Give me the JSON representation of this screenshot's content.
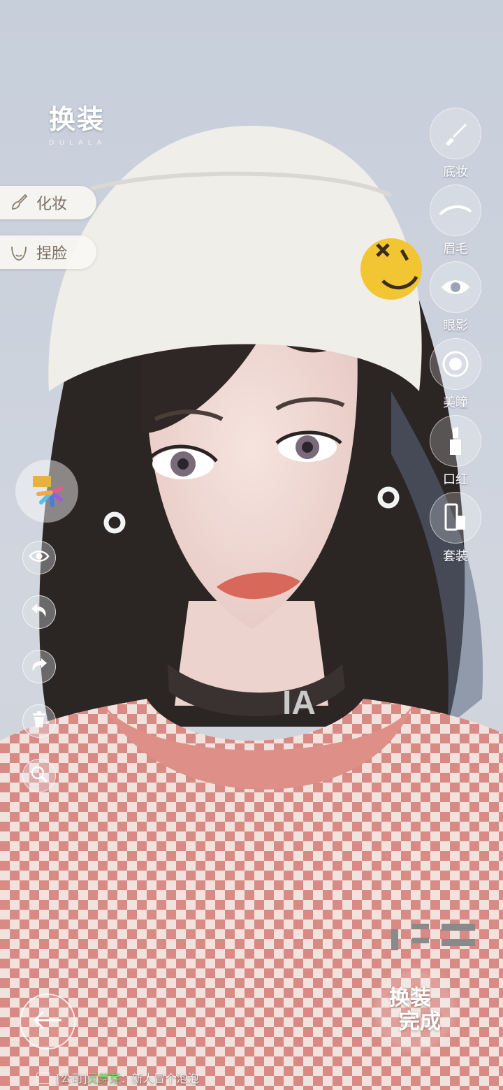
{
  "header": {
    "title": "换装",
    "subtitle": "DULALA"
  },
  "left_menu": [
    {
      "label": "化妆",
      "icon": "brush-icon"
    },
    {
      "label": "捏脸",
      "icon": "face-outline-icon"
    }
  ],
  "categories": [
    {
      "label": "底妆",
      "icon": "foundation-brush-icon"
    },
    {
      "label": "眉毛",
      "icon": "eyebrow-icon"
    },
    {
      "label": "眼影",
      "icon": "eye-icon"
    },
    {
      "label": "美瞳",
      "icon": "contact-lens-icon"
    },
    {
      "label": "口红",
      "icon": "lipstick-icon"
    },
    {
      "label": "套装",
      "icon": "cosmetics-set-icon"
    }
  ],
  "tools": [
    "palette-icon",
    "eye-visibility-icon",
    "undo-icon",
    "redo-icon",
    "trash-icon",
    "zoom-icon"
  ],
  "bottom": {
    "done_line1": "换装",
    "done_line2": "完成"
  },
  "chat": {
    "channel": "[公司]",
    "user": "灵芽芽",
    "sep": "：",
    "message": "新人冒个泡泡"
  },
  "colors": {
    "accent_green": "#7ee07a",
    "background": "#cdd3dd"
  }
}
